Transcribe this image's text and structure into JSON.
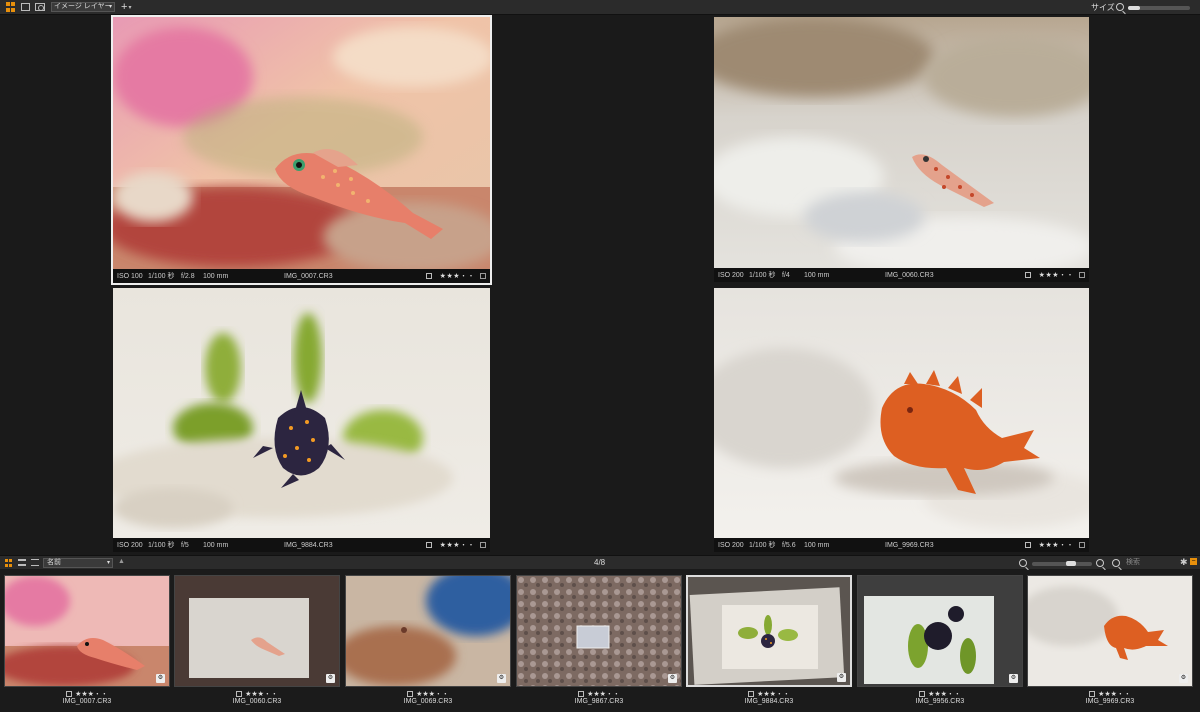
{
  "toolbar": {
    "layer_select": "イメージ レイヤー",
    "add_label": "+",
    "size_label": "サイズ"
  },
  "panels": [
    {
      "iso": "ISO 100",
      "shutter": "1/100 秒",
      "fnum": "f/2.8",
      "focal": "100 mm",
      "name": "IMG_0007.CR3",
      "rating": "★★★・・"
    },
    {
      "iso": "ISO 200",
      "shutter": "1/100 秒",
      "fnum": "f/4",
      "focal": "100 mm",
      "name": "IMG_0060.CR3",
      "rating": "★★★・・"
    },
    {
      "iso": "ISO 200",
      "shutter": "1/100 秒",
      "fnum": "f/5",
      "focal": "100 mm",
      "name": "IMG_9884.CR3",
      "rating": "★★★・・"
    },
    {
      "iso": "ISO 200",
      "shutter": "1/100 秒",
      "fnum": "f/5.6",
      "focal": "100 mm",
      "name": "IMG_9969.CR3",
      "rating": "★★★・・"
    }
  ],
  "stripbar": {
    "sort_select": "名前",
    "counter": "4/8",
    "search_placeholder": "検索"
  },
  "thumbnails": [
    {
      "name": "IMG_0007.CR3",
      "rating": "★★★・・"
    },
    {
      "name": "IMG_0060.CR3",
      "rating": "★★★・・"
    },
    {
      "name": "IMG_0069.CR3",
      "rating": "★★★・・"
    },
    {
      "name": "IMG_9867.CR3",
      "rating": "★★★・・"
    },
    {
      "name": "IMG_9884.CR3",
      "rating": "★★★・・"
    },
    {
      "name": "IMG_9956.CR3",
      "rating": "★★★・・"
    },
    {
      "name": "IMG_9969.CR3",
      "rating": "★★★・・"
    }
  ],
  "colors": {
    "accent": "#e8900c",
    "background": "#1a1a1a",
    "toolbar": "#2b2b2b"
  },
  "icons": [
    "grid-view-icon",
    "single-view-icon",
    "compare-view-icon",
    "zoom-icon",
    "list-view-icon",
    "search-icon",
    "gear-icon",
    "minus-icon"
  ]
}
